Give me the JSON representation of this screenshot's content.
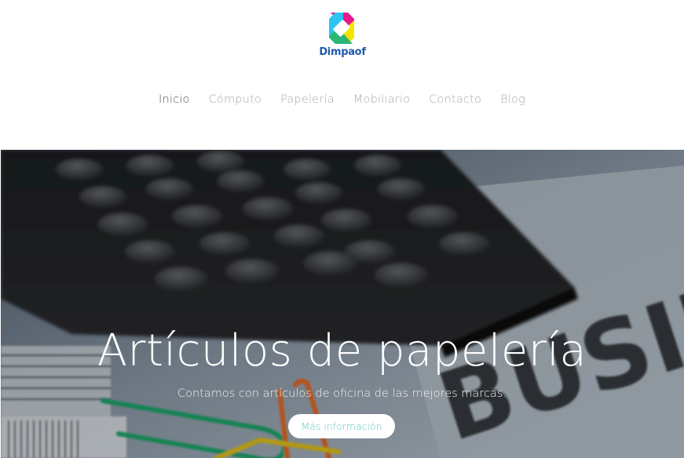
{
  "brand": {
    "name": "Dimpaof",
    "colors": {
      "pink": "#e8198b",
      "yellow": "#f5e300",
      "green": "#2bb673",
      "blue": "#1e5bab",
      "cyan": "#2ec4f1"
    }
  },
  "nav": {
    "items": [
      {
        "label": "Inicio",
        "active": true
      },
      {
        "label": "Cómputo"
      },
      {
        "label": "Papelería"
      },
      {
        "label": "Mobiliario"
      },
      {
        "label": "Contacto"
      },
      {
        "label": "Blog"
      }
    ]
  },
  "hero": {
    "title": "Artículos de papelería",
    "subtitle": "Contamos con artículos de oficina de las mejores marcas.",
    "button_label": "Más información",
    "button_text_color": "#5fc8bc"
  }
}
